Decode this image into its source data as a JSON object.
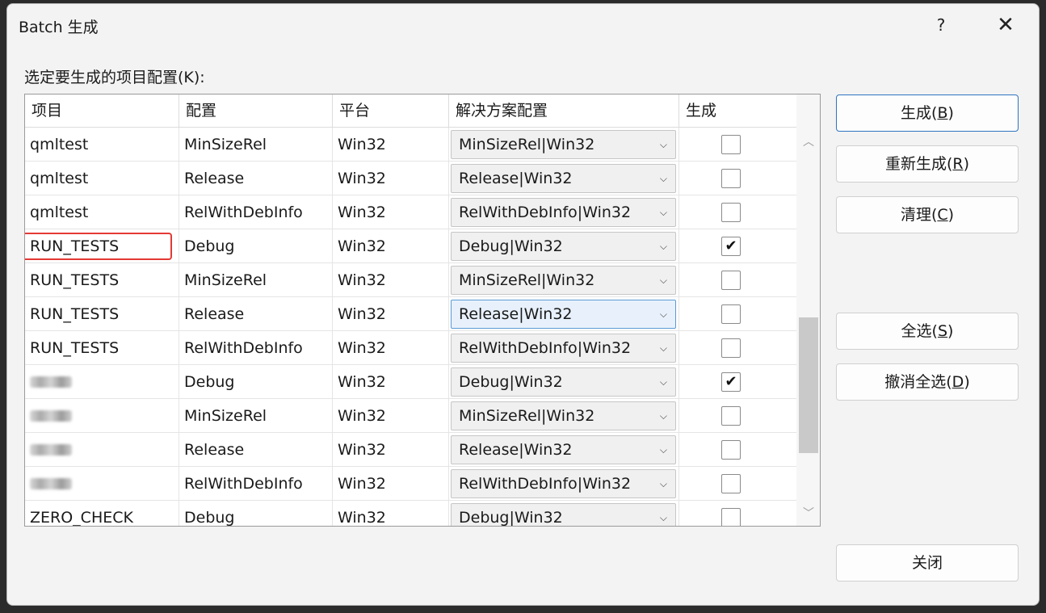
{
  "dialog": {
    "title": "Batch 生成",
    "help_label": "?",
    "close_label": "✕"
  },
  "section_label": "选定要生成的项目配置(K):",
  "columns": [
    "项目",
    "配置",
    "平台",
    "解决方案配置",
    "生成"
  ],
  "rows": [
    {
      "project": "qmltest",
      "config": "MinSizeRel",
      "platform": "Win32",
      "solution": "MinSizeRel|Win32",
      "build": false
    },
    {
      "project": "qmltest",
      "config": "Release",
      "platform": "Win32",
      "solution": "Release|Win32",
      "build": false
    },
    {
      "project": "qmltest",
      "config": "RelWithDebInfo",
      "platform": "Win32",
      "solution": "RelWithDebInfo|Win32",
      "build": false
    },
    {
      "project": "RUN_TESTS",
      "config": "Debug",
      "platform": "Win32",
      "solution": "Debug|Win32",
      "build": true
    },
    {
      "project": "RUN_TESTS",
      "config": "MinSizeRel",
      "platform": "Win32",
      "solution": "MinSizeRel|Win32",
      "build": false
    },
    {
      "project": "RUN_TESTS",
      "config": "Release",
      "platform": "Win32",
      "solution": "Release|Win32",
      "build": false
    },
    {
      "project": "RUN_TESTS",
      "config": "RelWithDebInfo",
      "platform": "Win32",
      "solution": "RelWithDebInfo|Win32",
      "build": false
    },
    {
      "project": "",
      "config": "Debug",
      "platform": "Win32",
      "solution": "Debug|Win32",
      "build": true
    },
    {
      "project": "",
      "config": "MinSizeRel",
      "platform": "Win32",
      "solution": "MinSizeRel|Win32",
      "build": false
    },
    {
      "project": "",
      "config": "Release",
      "platform": "Win32",
      "solution": "Release|Win32",
      "build": false
    },
    {
      "project": "",
      "config": "RelWithDebInfo",
      "platform": "Win32",
      "solution": "RelWithDebInfo|Win32",
      "build": false
    },
    {
      "project": "ZERO_CHECK",
      "config": "Debug",
      "platform": "Win32",
      "solution": "Debug|Win32",
      "build": false
    }
  ],
  "buttons": {
    "build": {
      "label": "生成(",
      "key": "B",
      "suffix": ")"
    },
    "rebuild": {
      "label": "重新生成(",
      "key": "R",
      "suffix": ")"
    },
    "clean": {
      "label": "清理(",
      "key": "C",
      "suffix": ")"
    },
    "select_all": {
      "label": "全选(",
      "key": "S",
      "suffix": ")"
    },
    "deselect_all": {
      "label": "撤消全选(",
      "key": "D",
      "suffix": ")"
    },
    "close": {
      "label": "关闭"
    }
  },
  "colors": {
    "highlight": "#e53935",
    "focus": "#5b9bd5",
    "primary_border": "#2f74c0"
  }
}
